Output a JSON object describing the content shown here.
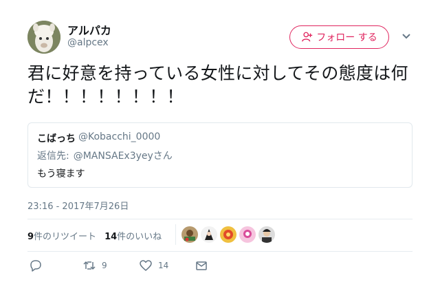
{
  "author": {
    "display_name": "アルパカ",
    "handle": "@alpcex"
  },
  "follow_button": {
    "label": "フォロー する"
  },
  "tweet": {
    "text": "君に好意を持っている女性に対してその態度は何だ！！！！！！！！",
    "timestamp": "23:16 - 2017年7月26日"
  },
  "quoted": {
    "name": "こばっち",
    "handle": "@Kobacchi_0000",
    "reply_label": "返信先:",
    "reply_user": "@MANSAEx3yeyさん",
    "text": "もう寝ます"
  },
  "stats": {
    "retweets_count": "9",
    "retweets_label": "件のリツイート",
    "likes_count": "14",
    "likes_label": "件のいいね"
  },
  "actions": {
    "reply_icon": "reply-icon",
    "retweet_count": "9",
    "like_count": "14",
    "dm_icon": "envelope-icon"
  },
  "colors": {
    "accent": "#e0245e",
    "muted": "#657786",
    "text": "#14171a",
    "border": "#e1e8ed"
  }
}
